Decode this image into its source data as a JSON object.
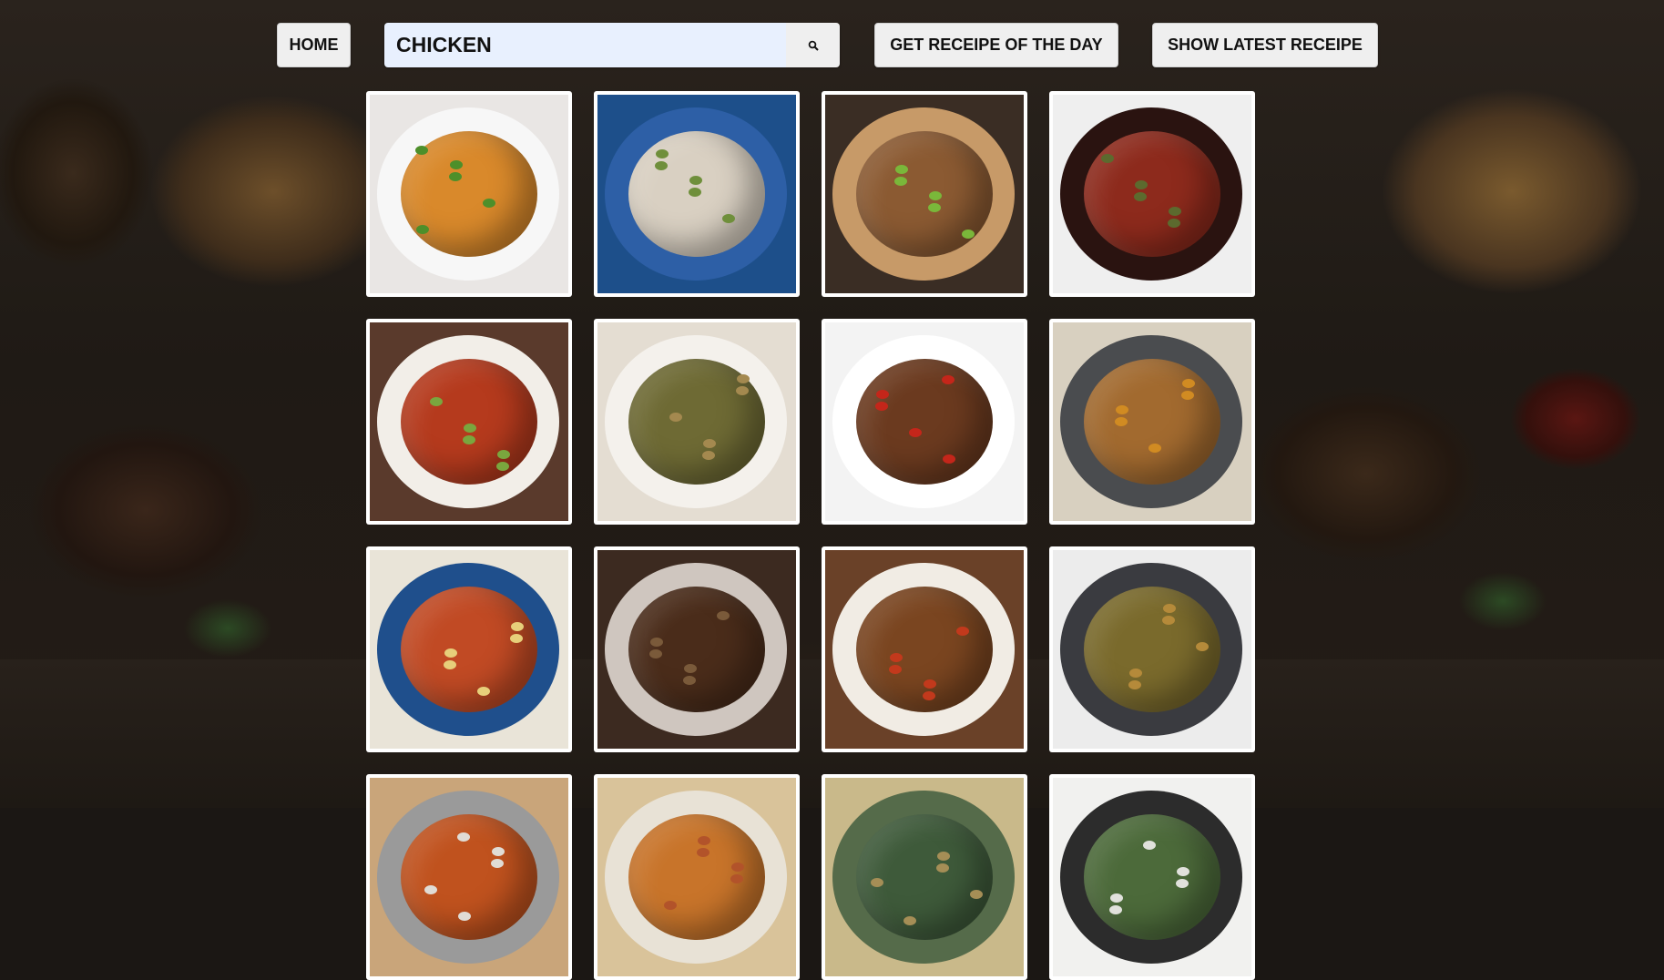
{
  "nav": {
    "home_label": "HOME",
    "receipe_of_day_label": "GET RECEIPE OF THE DAY",
    "latest_receipe_label": "SHOW LATEST RECEIPE"
  },
  "search": {
    "value": "CHICKEN",
    "button_icon": "search-icon"
  },
  "results": [
    {
      "name": "recipe-image-1",
      "bg": "#e9e6e4",
      "plate": "#f7f7f7",
      "food": "#d9892b",
      "accent": "#4d8f2a"
    },
    {
      "name": "recipe-image-2",
      "bg": "#1d4f8a",
      "plate": "#2d5fa6",
      "food": "#d9d0c2",
      "accent": "#6f8f3b"
    },
    {
      "name": "recipe-image-3",
      "bg": "#3a2d24",
      "plate": "#c79a68",
      "food": "#8b5a32",
      "accent": "#7ab73a"
    },
    {
      "name": "recipe-image-4",
      "bg": "#efefef",
      "plate": "#2a1310",
      "food": "#8d2a1c",
      "accent": "#5c6a2e"
    },
    {
      "name": "recipe-image-5",
      "bg": "#5a3a2c",
      "plate": "#f2eee8",
      "food": "#b53a1d",
      "accent": "#7aa63e"
    },
    {
      "name": "recipe-image-6",
      "bg": "#e4ddd2",
      "plate": "#f4f1ec",
      "food": "#6e6a34",
      "accent": "#a4894f"
    },
    {
      "name": "recipe-image-7",
      "bg": "#f3f3f3",
      "plate": "#ffffff",
      "food": "#6b3a1f",
      "accent": "#c4261a"
    },
    {
      "name": "recipe-image-8",
      "bg": "#d8d0c0",
      "plate": "#4a4c4f",
      "food": "#a26a2f",
      "accent": "#d18b22"
    },
    {
      "name": "recipe-image-9",
      "bg": "#e9e4d8",
      "plate": "#1f4f8c",
      "food": "#c14a24",
      "accent": "#e7cf7a"
    },
    {
      "name": "recipe-image-10",
      "bg": "#3c2a20",
      "plate": "#cfc6bf",
      "food": "#4a2c1a",
      "accent": "#7a5a3a"
    },
    {
      "name": "recipe-image-11",
      "bg": "#6a4128",
      "plate": "#f1ece4",
      "food": "#7a4520",
      "accent": "#c2391c"
    },
    {
      "name": "recipe-image-12",
      "bg": "#ececec",
      "plate": "#3a3b40",
      "food": "#7a6a2c",
      "accent": "#b58a3a"
    },
    {
      "name": "recipe-image-13",
      "bg": "#c9a57a",
      "plate": "#9a9a9a",
      "food": "#c0521e",
      "accent": "#e0dcd5"
    },
    {
      "name": "recipe-image-14",
      "bg": "#d9c39a",
      "plate": "#e8e2d6",
      "food": "#c8742a",
      "accent": "#b2532a"
    },
    {
      "name": "recipe-image-15",
      "bg": "#c9b98a",
      "plate": "#556b4a",
      "food": "#3e5a3a",
      "accent": "#a58e56"
    },
    {
      "name": "recipe-image-16",
      "bg": "#f1f1ef",
      "plate": "#2c2c2c",
      "food": "#4c6a3a",
      "accent": "#e1e1dc"
    }
  ]
}
